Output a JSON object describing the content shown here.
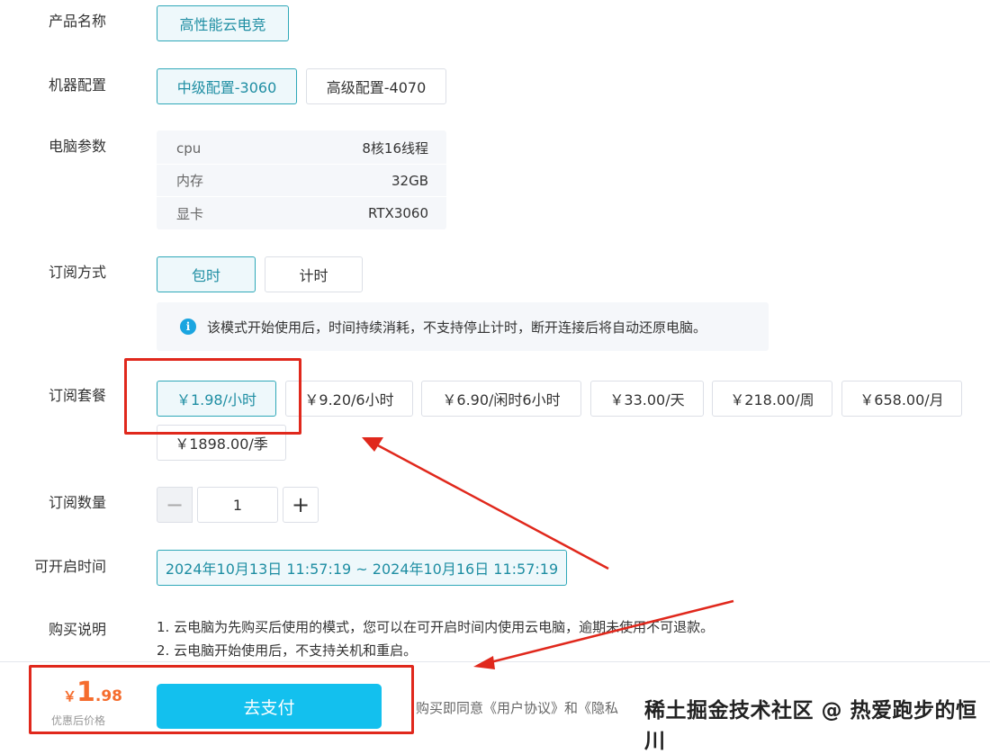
{
  "labels": {
    "product": "产品名称",
    "machine": "机器配置",
    "params": "电脑参数",
    "subscription": "订阅方式",
    "package": "订阅套餐",
    "quantity": "订阅数量",
    "open_time": "可开启时间",
    "purchase_notes": "购买说明"
  },
  "product": {
    "name": "高性能云电竞"
  },
  "machine": {
    "options": [
      "中级配置-3060",
      "高级配置-4070"
    ],
    "selected": "中级配置-3060"
  },
  "params": [
    {
      "key": "cpu",
      "value": "8核16线程"
    },
    {
      "key": "内存",
      "value": "32GB"
    },
    {
      "key": "显卡",
      "value": "RTX3060"
    }
  ],
  "subscription": {
    "options": [
      "包时",
      "计时"
    ],
    "selected": "包时",
    "notice": "该模式开始使用后，时间持续消耗，不支持停止计时，断开连接后将自动还原电脑。"
  },
  "packages": {
    "options": [
      "￥1.98/小时",
      "￥9.20/6小时",
      "￥6.90/闲时6小时",
      "￥33.00/天",
      "￥218.00/周",
      "￥658.00/月",
      "￥1898.00/季"
    ],
    "selected": "￥1.98/小时"
  },
  "quantity": {
    "minus": "−",
    "value": "1",
    "plus": "+"
  },
  "open_time": "2024年10月13日 11:57:19 ~ 2024年10月16日 11:57:19",
  "notes": [
    "1. 云电脑为先购买后使用的模式，您可以在可开启时间内使用云电脑，逾期未使用不可退款。",
    "2. 云电脑开始使用后，不支持关机和重启。"
  ],
  "footer": {
    "currency": "￥",
    "price_int": "1",
    "price_dec": ".98",
    "price_label": "优惠后价格",
    "pay_button": "去支付",
    "agreement": "购买即同意《用户协议》和《隐私",
    "watermark": "稀土掘金技术社区 @ 热爱跑步的恒川"
  },
  "annotation_color": "#e0281c",
  "accent_color": "#13c0ee"
}
